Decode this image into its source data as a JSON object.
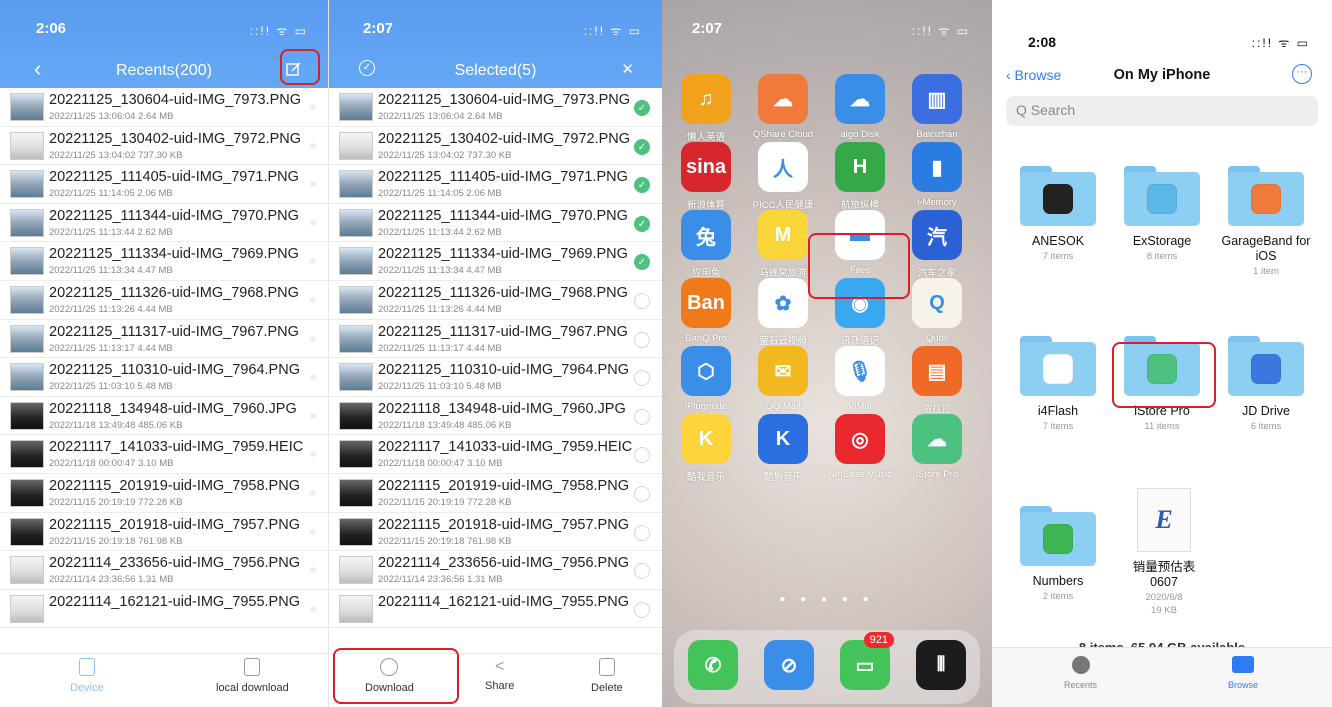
{
  "panel1": {
    "time": "2:06",
    "status": "::!! ᯤ ▭",
    "back": "‹",
    "title": "Recents(200)",
    "files": [
      {
        "name": "20221125_130604-uid-IMG_7973.PNG",
        "meta": "2022/11/25 13:06:04 2.64 MB"
      },
      {
        "name": "20221125_130402-uid-IMG_7972.PNG",
        "meta": "2022/11/25 13:04:02 737.30 KB"
      },
      {
        "name": "20221125_111405-uid-IMG_7971.PNG",
        "meta": "2022/11/25 11:14:05 2.06 MB"
      },
      {
        "name": "20221125_111344-uid-IMG_7970.PNG",
        "meta": "2022/11/25 11:13:44 2.62 MB"
      },
      {
        "name": "20221125_111334-uid-IMG_7969.PNG",
        "meta": "2022/11/25 11:13:34 4.47 MB"
      },
      {
        "name": "20221125_111326-uid-IMG_7968.PNG",
        "meta": "2022/11/25 11:13:26 4.44 MB"
      },
      {
        "name": "20221125_111317-uid-IMG_7967.PNG",
        "meta": "2022/11/25 11:13:17 4.44 MB"
      },
      {
        "name": "20221125_110310-uid-IMG_7964.PNG",
        "meta": "2022/11/25 11:03:10 5.48 MB"
      },
      {
        "name": "20221118_134948-uid-IMG_7960.JPG",
        "meta": "2022/11/18 13:49:48 485.06 KB"
      },
      {
        "name": "20221117_141033-uid-IMG_7959.HEIC",
        "meta": "2022/11/18 00:00:47 3.10 MB"
      },
      {
        "name": "20221115_201919-uid-IMG_7958.PNG",
        "meta": "2022/11/15 20:19:19 772.28 KB"
      },
      {
        "name": "20221115_201918-uid-IMG_7957.PNG",
        "meta": "2022/11/15 20:19:18 761.98 KB"
      },
      {
        "name": "20221114_233656-uid-IMG_7956.PNG",
        "meta": "2022/11/14 23:36:56 1.31 MB"
      },
      {
        "name": "20221114_162121-uid-IMG_7955.PNG",
        "meta": ""
      }
    ],
    "bottom": {
      "device": "Device",
      "local_download": "local download"
    }
  },
  "panel2": {
    "time": "2:07",
    "status": "::!! ᯤ ▭",
    "title": "Selected(5)",
    "close": "✕",
    "selected_count": 5,
    "bottom": {
      "download": "Download",
      "share": "Share",
      "delete": "Delete"
    }
  },
  "panel3": {
    "time": "2:07",
    "status": "::!! ᯤ ▭",
    "apps": [
      {
        "label": "懒人英语",
        "color": "#f2a11b",
        "glyph": "♫"
      },
      {
        "label": "QShare Cloud",
        "color": "#f07a3c",
        "glyph": "☁"
      },
      {
        "label": "aigo Disk",
        "color": "#3a8ee8",
        "glyph": "☁"
      },
      {
        "label": "Baicizhan",
        "color": "#3b6ee0",
        "glyph": "▥"
      },
      {
        "label": "新浪体育",
        "color": "#d7262c",
        "glyph": "sina"
      },
      {
        "label": "PICC人民健康",
        "color": "#ffffff",
        "glyph": "人"
      },
      {
        "label": "航旅纵横",
        "color": "#35a848",
        "glyph": "H"
      },
      {
        "label": "i-Memory",
        "color": "#2a7ce3",
        "glyph": "▮"
      },
      {
        "label": "应用兔",
        "color": "#3a8ee8",
        "glyph": "兔"
      },
      {
        "label": "马蜂窝旅游",
        "color": "#f9d53a",
        "glyph": "M"
      },
      {
        "label": "Files",
        "color": "#ffffff",
        "glyph": "▬"
      },
      {
        "label": "汽车之家",
        "color": "#2a62d6",
        "glyph": "汽"
      },
      {
        "label": "BanQ Pro",
        "color": "#f07a1a",
        "glyph": "Ban"
      },
      {
        "label": "萤石云视频",
        "color": "#ffffff",
        "glyph": "✿"
      },
      {
        "label": "讯飞语记",
        "color": "#3aa8ee",
        "glyph": "◉"
      },
      {
        "label": "Qubii",
        "color": "#f7f3ea",
        "glyph": "Q"
      },
      {
        "label": "iPlugmate",
        "color": "#3a8ee8",
        "glyph": "⬡"
      },
      {
        "label": "QQ Mail",
        "color": "#f2b81f",
        "glyph": "✉"
      },
      {
        "label": "ViMai",
        "color": "#ffffff",
        "glyph": "🎙"
      },
      {
        "label": "货拉拉",
        "color": "#f06a25",
        "glyph": "▤"
      },
      {
        "label": "酷我音乐",
        "color": "#ffd33a",
        "glyph": "K"
      },
      {
        "label": "酷狗音乐",
        "color": "#2b6ee0",
        "glyph": "K"
      },
      {
        "label": "NetEase Music",
        "color": "#e8272f",
        "glyph": "◎"
      },
      {
        "label": "iStore Pro",
        "color": "#4cc27e",
        "glyph": "☁"
      }
    ],
    "dock": [
      {
        "label": "Phone",
        "color": "#45c35b",
        "glyph": "✆"
      },
      {
        "label": "Safari",
        "color": "#3a8ee8",
        "glyph": "⊘"
      },
      {
        "label": "Messages",
        "color": "#45c35b",
        "glyph": "▭",
        "badge": "921"
      },
      {
        "label": "Voice Memos",
        "color": "#1c1c1e",
        "glyph": "⦀"
      }
    ]
  },
  "panel4": {
    "time": "2:08",
    "status": "::!! ᯤ ▭",
    "back": "‹ Browse",
    "title": "On My iPhone",
    "search_placeholder": "Q Search",
    "folders": [
      {
        "name": "ANESOK",
        "count": "7 items",
        "color": "#222222"
      },
      {
        "name": "ExStorage",
        "count": "8 items",
        "color": "#5ab7e8"
      },
      {
        "name": "GarageBand for iOS",
        "count": "1 item",
        "color": "#f07a3c"
      },
      {
        "name": "i4Flash",
        "count": "7 items",
        "color": "#ffffff"
      },
      {
        "name": "iStore Pro",
        "count": "11 items",
        "color": "#4cc27e"
      },
      {
        "name": "JD Drive",
        "count": "6 items",
        "color": "#3a78e0"
      },
      {
        "name": "Numbers",
        "count": "2 items",
        "color": "#3cb552"
      }
    ],
    "doc": {
      "name": "销量预估表 0607",
      "date": "2020/6/8",
      "size": "19 KB",
      "glyph": "E"
    },
    "storage": "8 items, 65.94 GB available",
    "tabs": {
      "recents": "Recents",
      "browse": "Browse"
    }
  }
}
